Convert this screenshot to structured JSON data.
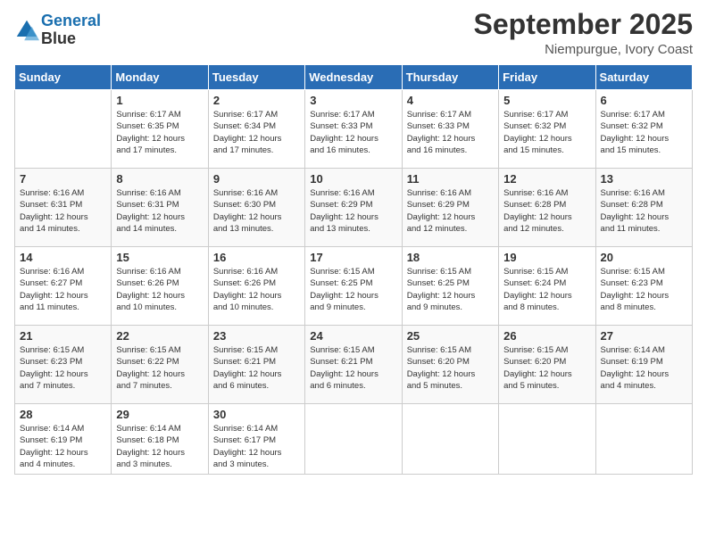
{
  "logo": {
    "line1": "General",
    "line2": "Blue"
  },
  "title": "September 2025",
  "location": "Niempurgue, Ivory Coast",
  "weekdays": [
    "Sunday",
    "Monday",
    "Tuesday",
    "Wednesday",
    "Thursday",
    "Friday",
    "Saturday"
  ],
  "weeks": [
    [
      {
        "day": "",
        "info": ""
      },
      {
        "day": "1",
        "info": "Sunrise: 6:17 AM\nSunset: 6:35 PM\nDaylight: 12 hours\nand 17 minutes."
      },
      {
        "day": "2",
        "info": "Sunrise: 6:17 AM\nSunset: 6:34 PM\nDaylight: 12 hours\nand 17 minutes."
      },
      {
        "day": "3",
        "info": "Sunrise: 6:17 AM\nSunset: 6:33 PM\nDaylight: 12 hours\nand 16 minutes."
      },
      {
        "day": "4",
        "info": "Sunrise: 6:17 AM\nSunset: 6:33 PM\nDaylight: 12 hours\nand 16 minutes."
      },
      {
        "day": "5",
        "info": "Sunrise: 6:17 AM\nSunset: 6:32 PM\nDaylight: 12 hours\nand 15 minutes."
      },
      {
        "day": "6",
        "info": "Sunrise: 6:17 AM\nSunset: 6:32 PM\nDaylight: 12 hours\nand 15 minutes."
      }
    ],
    [
      {
        "day": "7",
        "info": "Sunrise: 6:16 AM\nSunset: 6:31 PM\nDaylight: 12 hours\nand 14 minutes."
      },
      {
        "day": "8",
        "info": "Sunrise: 6:16 AM\nSunset: 6:31 PM\nDaylight: 12 hours\nand 14 minutes."
      },
      {
        "day": "9",
        "info": "Sunrise: 6:16 AM\nSunset: 6:30 PM\nDaylight: 12 hours\nand 13 minutes."
      },
      {
        "day": "10",
        "info": "Sunrise: 6:16 AM\nSunset: 6:29 PM\nDaylight: 12 hours\nand 13 minutes."
      },
      {
        "day": "11",
        "info": "Sunrise: 6:16 AM\nSunset: 6:29 PM\nDaylight: 12 hours\nand 12 minutes."
      },
      {
        "day": "12",
        "info": "Sunrise: 6:16 AM\nSunset: 6:28 PM\nDaylight: 12 hours\nand 12 minutes."
      },
      {
        "day": "13",
        "info": "Sunrise: 6:16 AM\nSunset: 6:28 PM\nDaylight: 12 hours\nand 11 minutes."
      }
    ],
    [
      {
        "day": "14",
        "info": "Sunrise: 6:16 AM\nSunset: 6:27 PM\nDaylight: 12 hours\nand 11 minutes."
      },
      {
        "day": "15",
        "info": "Sunrise: 6:16 AM\nSunset: 6:26 PM\nDaylight: 12 hours\nand 10 minutes."
      },
      {
        "day": "16",
        "info": "Sunrise: 6:16 AM\nSunset: 6:26 PM\nDaylight: 12 hours\nand 10 minutes."
      },
      {
        "day": "17",
        "info": "Sunrise: 6:15 AM\nSunset: 6:25 PM\nDaylight: 12 hours\nand 9 minutes."
      },
      {
        "day": "18",
        "info": "Sunrise: 6:15 AM\nSunset: 6:25 PM\nDaylight: 12 hours\nand 9 minutes."
      },
      {
        "day": "19",
        "info": "Sunrise: 6:15 AM\nSunset: 6:24 PM\nDaylight: 12 hours\nand 8 minutes."
      },
      {
        "day": "20",
        "info": "Sunrise: 6:15 AM\nSunset: 6:23 PM\nDaylight: 12 hours\nand 8 minutes."
      }
    ],
    [
      {
        "day": "21",
        "info": "Sunrise: 6:15 AM\nSunset: 6:23 PM\nDaylight: 12 hours\nand 7 minutes."
      },
      {
        "day": "22",
        "info": "Sunrise: 6:15 AM\nSunset: 6:22 PM\nDaylight: 12 hours\nand 7 minutes."
      },
      {
        "day": "23",
        "info": "Sunrise: 6:15 AM\nSunset: 6:21 PM\nDaylight: 12 hours\nand 6 minutes."
      },
      {
        "day": "24",
        "info": "Sunrise: 6:15 AM\nSunset: 6:21 PM\nDaylight: 12 hours\nand 6 minutes."
      },
      {
        "day": "25",
        "info": "Sunrise: 6:15 AM\nSunset: 6:20 PM\nDaylight: 12 hours\nand 5 minutes."
      },
      {
        "day": "26",
        "info": "Sunrise: 6:15 AM\nSunset: 6:20 PM\nDaylight: 12 hours\nand 5 minutes."
      },
      {
        "day": "27",
        "info": "Sunrise: 6:14 AM\nSunset: 6:19 PM\nDaylight: 12 hours\nand 4 minutes."
      }
    ],
    [
      {
        "day": "28",
        "info": "Sunrise: 6:14 AM\nSunset: 6:19 PM\nDaylight: 12 hours\nand 4 minutes."
      },
      {
        "day": "29",
        "info": "Sunrise: 6:14 AM\nSunset: 6:18 PM\nDaylight: 12 hours\nand 3 minutes."
      },
      {
        "day": "30",
        "info": "Sunrise: 6:14 AM\nSunset: 6:17 PM\nDaylight: 12 hours\nand 3 minutes."
      },
      {
        "day": "",
        "info": ""
      },
      {
        "day": "",
        "info": ""
      },
      {
        "day": "",
        "info": ""
      },
      {
        "day": "",
        "info": ""
      }
    ]
  ]
}
